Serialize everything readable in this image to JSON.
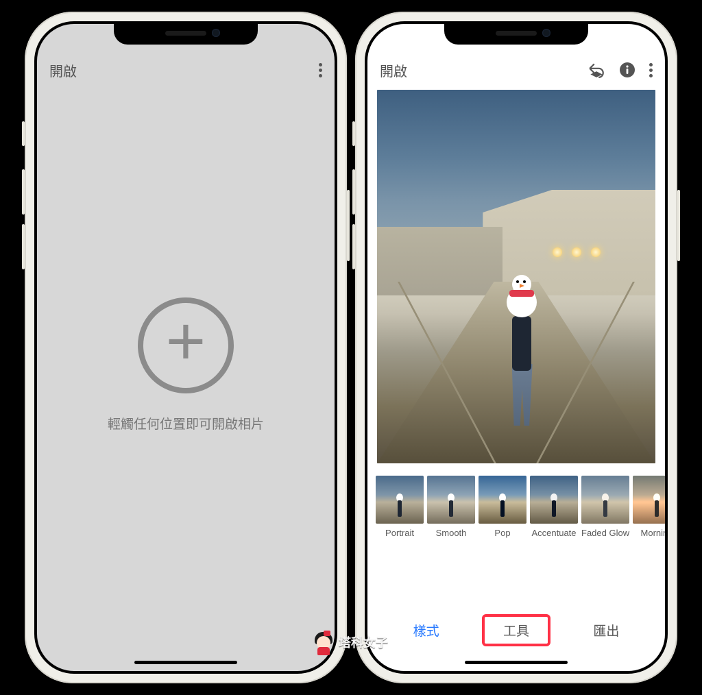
{
  "left_screen": {
    "open_label": "開啟",
    "prompt": "輕觸任何位置即可開啟相片"
  },
  "right_screen": {
    "open_label": "開啟",
    "filters": [
      {
        "name": "Portrait"
      },
      {
        "name": "Smooth"
      },
      {
        "name": "Pop"
      },
      {
        "name": "Accentuate"
      },
      {
        "name": "Faded Glow"
      },
      {
        "name": "Morning"
      }
    ],
    "tabs": {
      "styles": "樣式",
      "tools": "工具",
      "export": "匯出"
    }
  },
  "watermark": {
    "text": "塔科女子"
  }
}
